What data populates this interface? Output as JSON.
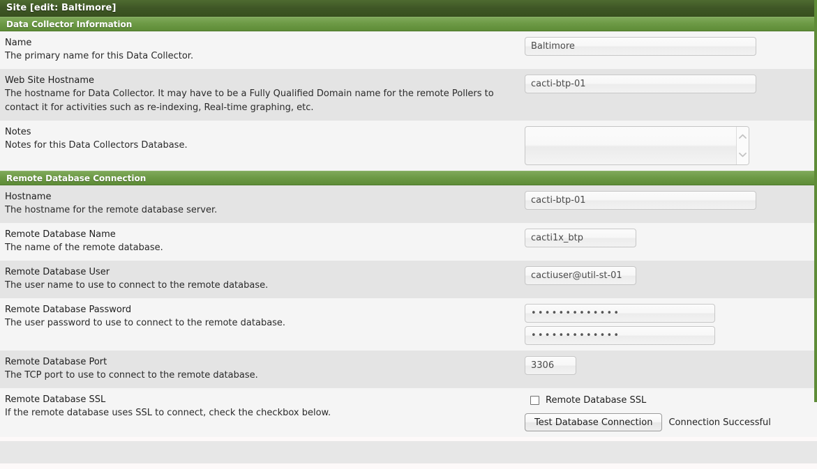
{
  "window": {
    "title": "Site [edit: Baltimore]"
  },
  "sections": [
    {
      "id": "data-collector-information",
      "header": "Data Collector Information",
      "rows": [
        {
          "id": "name",
          "label": "Name",
          "description": "The primary name for this Data Collector.",
          "control": "text",
          "value": "Baltimore"
        },
        {
          "id": "web-site-hostname",
          "label": "Web Site Hostname",
          "description": "The hostname for Data Collector. It may have to be a Fully Qualified Domain name for the remote Pollers to contact it for activities such as re-indexing, Real-time graphing, etc.",
          "control": "text",
          "value": "cacti-btp-01"
        },
        {
          "id": "notes",
          "label": "Notes",
          "description": "Notes for this Data Collectors Database.",
          "control": "textarea",
          "value": ""
        }
      ]
    },
    {
      "id": "remote-database-connection",
      "header": "Remote Database Connection",
      "rows": [
        {
          "id": "hostname",
          "label": "Hostname",
          "description": "The hostname for the remote database server.",
          "control": "text",
          "value": "cacti-btp-01"
        },
        {
          "id": "remote-database-name",
          "label": "Remote Database Name",
          "description": "The name of the remote database.",
          "control": "text",
          "value": "cacti1x_btp"
        },
        {
          "id": "remote-database-user",
          "label": "Remote Database User",
          "description": "The user name to use to connect to the remote database.",
          "control": "text",
          "value": "cactiuser@util-st-01"
        },
        {
          "id": "remote-database-password",
          "label": "Remote Database Password",
          "description": "The user password to use to connect to the remote database.",
          "control": "password-pair",
          "value": "•••••••••••••",
          "value_confirm": "•••••••••••••"
        },
        {
          "id": "remote-database-port",
          "label": "Remote Database Port",
          "description": "The TCP port to use to connect to the remote database.",
          "control": "text",
          "value": "3306"
        },
        {
          "id": "remote-database-ssl",
          "label": "Remote Database SSL",
          "description": "If the remote database uses SSL to connect, check the checkbox below.",
          "control": "checkbox-and-button",
          "checkbox_label": "Remote Database SSL",
          "checked": false,
          "button_label": "Test Database Connection",
          "status_text": "Connection Successful"
        }
      ]
    }
  ],
  "colors": {
    "title_bar": "#3f5726",
    "section_header": "#6d9a46",
    "row_odd": "#f5f5f5",
    "row_even": "#e4e4e4",
    "page_background": "#fdf9f9"
  }
}
